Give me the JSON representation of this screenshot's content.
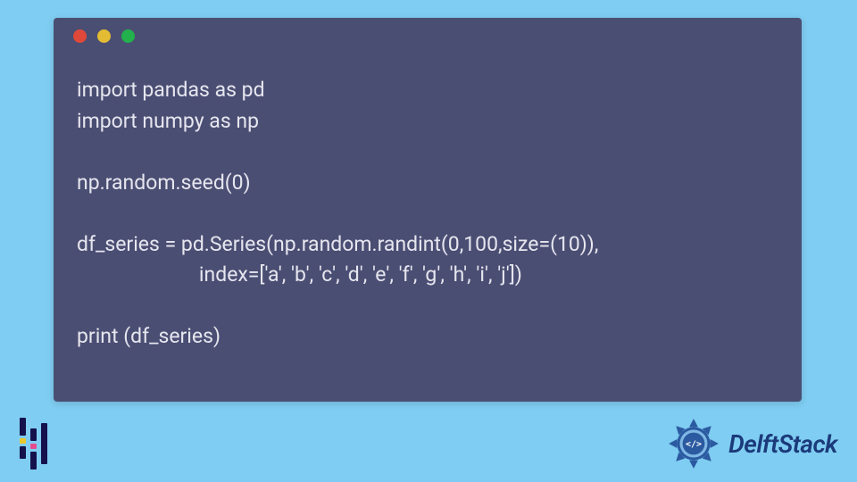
{
  "code": {
    "line1": "import pandas as pd",
    "line2": "import numpy as np",
    "line3": "",
    "line4": "np.random.seed(0)",
    "line5": "",
    "line6": "df_series = pd.Series(np.random.randint(0,100,size=(10)),",
    "line7": "                        index=['a', 'b', 'c', 'd', 'e', 'f', 'g', 'h', 'i', 'j'])",
    "line8": "",
    "line9": "print (df_series)"
  },
  "brand": {
    "name": "DelftStack"
  },
  "colors": {
    "bg": "#7fcdf2",
    "window": "#4b4e73",
    "code_text": "#e6e6ef",
    "brand_text": "#1b3a7a",
    "badge_primary": "#2b5aa0",
    "badge_accent": "#7fb8e5"
  }
}
